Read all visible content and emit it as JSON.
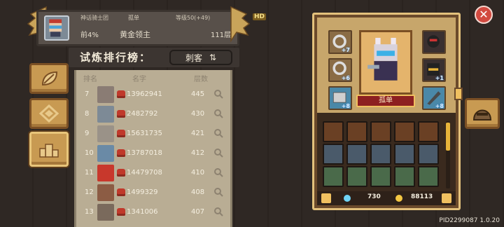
{
  "profile": {
    "guild": "神话骑士团",
    "player_name": "孤单",
    "level": "等级50(+49)",
    "hd_badge": "HD",
    "percentile": "前4%",
    "tier": "黄金领主",
    "floor": "111层"
  },
  "ranking": {
    "title": "试炼排行榜：",
    "class_label": "刺客",
    "headers": {
      "rank": "排名",
      "name": "名字",
      "floor": "层数"
    },
    "rows": [
      {
        "rank": "7",
        "name": "13962941",
        "floor": "445",
        "color": "#8a7c74"
      },
      {
        "rank": "8",
        "name": "2482792",
        "floor": "430",
        "color": "#7d8a96"
      },
      {
        "rank": "9",
        "name": "15631735",
        "floor": "421",
        "color": "#9a9288"
      },
      {
        "rank": "10",
        "name": "13787018",
        "floor": "412",
        "color": "#6a8aa6"
      },
      {
        "rank": "11",
        "name": "14479708",
        "floor": "410",
        "color": "#c8382c"
      },
      {
        "rank": "12",
        "name": "1499329",
        "floor": "408",
        "color": "#8c5c44"
      },
      {
        "rank": "13",
        "name": "1341006",
        "floor": "407",
        "color": "#7a6a5c"
      }
    ]
  },
  "character": {
    "name": "孤单",
    "slots_left": [
      "+7",
      "+6",
      "+8"
    ],
    "slots_right": [
      "",
      "+1",
      "+8"
    ]
  },
  "inventory": {
    "gems": "730",
    "coins": "88113"
  },
  "close_label": "✕",
  "pid": "PID2299087 1.0.20",
  "icons": {
    "nav": [
      "leaf-icon",
      "diamond-icon",
      "podium-icon"
    ],
    "close": "close-icon",
    "helmet": "helmet-icon"
  }
}
